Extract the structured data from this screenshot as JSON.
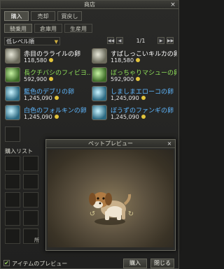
{
  "window": {
    "title": "商店",
    "close": "×"
  },
  "tabs": [
    {
      "label": "購入"
    },
    {
      "label": "売却"
    },
    {
      "label": "買戻し"
    }
  ],
  "subtabs": [
    {
      "label": "騎乗用"
    },
    {
      "label": "倉庫用"
    },
    {
      "label": "生産用"
    }
  ],
  "filter": {
    "selected": "低レベル順",
    "arrow": "▼"
  },
  "pager": {
    "prev2": "◀◀",
    "prev": "◀",
    "page": "1/1",
    "next": "▶",
    "next2": "▶▶"
  },
  "items": [
    {
      "name": "赤目のラライルの卵",
      "price": "118,580",
      "icon": "egg-icon",
      "color": "#ffffff"
    },
    {
      "name": "すばしっこいキルカの卵",
      "price": "118,580",
      "icon": "egg-icon",
      "color": "#ffffff"
    },
    {
      "name": "長クチバシのフィビヨ...",
      "price": "592,900",
      "icon": "egg-icon",
      "color": "#8fe05a"
    },
    {
      "name": "ぼっちゃりマシューの卵",
      "price": "592,900",
      "icon": "egg-icon",
      "color": "#8fe05a"
    },
    {
      "name": "藍色のデブリの卵",
      "price": "1,245,090",
      "icon": "egg-icon",
      "color": "#5fb8ff"
    },
    {
      "name": "しましまエローコの卵",
      "price": "1,245,090",
      "icon": "egg-icon",
      "color": "#5fb8ff"
    },
    {
      "name": "白色のフォルキンの卵",
      "price": "1,245,090",
      "icon": "egg-icon",
      "color": "#5fb8ff"
    },
    {
      "name": "ぼうずのファンギの卵",
      "price": "1,245,090",
      "icon": "egg-icon",
      "color": "#5fb8ff"
    }
  ],
  "purchase": {
    "label": "購入リスト",
    "behind_text": "所"
  },
  "bottom": {
    "checkbox_label": "アイテムのプレビュー",
    "checked": "✔",
    "buy": "購入",
    "close": "閉じる"
  },
  "preview": {
    "title": "ペットプレビュー",
    "close": "×",
    "rotate_left": "↺",
    "rotate_right": "↻"
  }
}
